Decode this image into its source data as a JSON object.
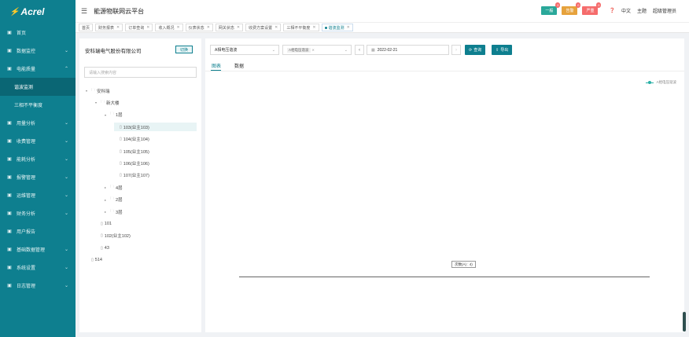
{
  "brand": {
    "logo_text": "Acrel"
  },
  "header": {
    "title": "能源物联网云平台",
    "badges": [
      {
        "label": "一般",
        "count": "0",
        "color": "#2aa89a"
      },
      {
        "label": "告警",
        "count": "0",
        "color": "#e6a23c"
      },
      {
        "label": "严重",
        "count": "0",
        "color": "#f56c6c"
      }
    ],
    "help_icon": "question-icon",
    "language": "中文",
    "theme": "主题",
    "user": "超级管理员"
  },
  "sidebar": {
    "items": [
      {
        "label": "首页",
        "icon": "home-icon",
        "chev": ""
      },
      {
        "label": "数据监控",
        "icon": "monitor-icon",
        "chev": "⌄"
      },
      {
        "label": "电能质量",
        "icon": "power-icon",
        "chev": "⌃"
      },
      {
        "label": "谐波监测",
        "sub": true,
        "active": true
      },
      {
        "label": "三相不平衡度",
        "sub": true
      },
      {
        "label": "用量分析",
        "icon": "analysis-icon",
        "chev": "⌄"
      },
      {
        "label": "收费管理",
        "icon": "fee-icon",
        "chev": "⌄"
      },
      {
        "label": "能耗分析",
        "icon": "energy-icon",
        "chev": "⌄"
      },
      {
        "label": "报警管理",
        "icon": "alarm-icon",
        "chev": "⌄"
      },
      {
        "label": "运维管理",
        "icon": "maintenance-icon",
        "chev": "⌄"
      },
      {
        "label": "财务分析",
        "icon": "finance-icon",
        "chev": "⌄"
      },
      {
        "label": "用户报告",
        "icon": "report-icon",
        "chev": ""
      },
      {
        "label": "基础数据管理",
        "icon": "data-icon",
        "chev": "⌄"
      },
      {
        "label": "系统设置",
        "icon": "settings-icon",
        "chev": "⌄"
      },
      {
        "label": "日志管理",
        "icon": "log-icon",
        "chev": "⌄"
      }
    ]
  },
  "tabs": [
    "首页",
    "财务报表",
    "订单查询",
    "收入概况",
    "仪表状态",
    "网关状态",
    "收费方案设置",
    "三相不平衡度",
    "谐波监测"
  ],
  "active_tab": "谐波监测",
  "left": {
    "company": "安科瑞电气股份有限公司",
    "switch_label": "切换",
    "search_placeholder": "请输入搜索内容",
    "tree": [
      {
        "label": "安科瑞",
        "level": 0,
        "arrow": "▾",
        "type": "folder"
      },
      {
        "label": "新大楼",
        "level": 1,
        "arrow": "▾",
        "type": "folder"
      },
      {
        "label": "1层",
        "level": 2,
        "arrow": "▾",
        "type": "folder"
      },
      {
        "label": "103(业主103)",
        "level": 3,
        "arrow": "",
        "type": "meter",
        "selected": true
      },
      {
        "label": "104(业主104)",
        "level": 3,
        "arrow": "",
        "type": "meter"
      },
      {
        "label": "105(业主105)",
        "level": 3,
        "arrow": "",
        "type": "meter"
      },
      {
        "label": "106(业主106)",
        "level": 3,
        "arrow": "",
        "type": "meter"
      },
      {
        "label": "107(业主107)",
        "level": 3,
        "arrow": "",
        "type": "meter"
      },
      {
        "label": "4层",
        "level": 2,
        "arrow": "▸",
        "type": "folder"
      },
      {
        "label": "2层",
        "level": 2,
        "arrow": "▸",
        "type": "folder"
      },
      {
        "label": "3层",
        "level": 2,
        "arrow": "▸",
        "type": "folder"
      },
      {
        "label": "101",
        "level": 1,
        "arrow": "",
        "type": "meter"
      },
      {
        "label": "102(业主102)",
        "level": 1,
        "arrow": "",
        "type": "meter"
      },
      {
        "label": "43",
        "level": 1,
        "arrow": "",
        "type": "meter"
      },
      {
        "label": "514",
        "level": 0,
        "arrow": "",
        "type": "meter"
      }
    ]
  },
  "main": {
    "param_select": "A相电压谐波",
    "series_select": "A相电压谐波",
    "date": "2022-02-21",
    "query_label": "查询",
    "export_label": "导出",
    "tab_chart": "图表",
    "tab_data": "数据",
    "legend": "A相电压谐波",
    "tooltip": "次数(A) : 4)"
  }
}
